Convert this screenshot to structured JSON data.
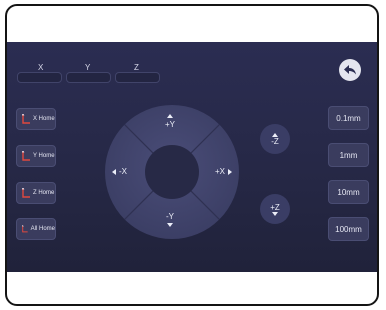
{
  "coordinates": {
    "x_label": "X",
    "y_label": "Y",
    "z_label": "Z"
  },
  "home_buttons": [
    {
      "label": "X Home"
    },
    {
      "label": "Y Home"
    },
    {
      "label": "Z Home"
    },
    {
      "label": "All Home"
    }
  ],
  "jog": {
    "plus_y": "+Y",
    "minus_y": "-Y",
    "minus_x": "-X",
    "plus_x": "+X"
  },
  "z_buttons": {
    "minus_z": "-Z",
    "plus_z": "+Z"
  },
  "step_buttons": [
    {
      "label": "0.1mm"
    },
    {
      "label": "1mm"
    },
    {
      "label": "10mm"
    },
    {
      "label": "100mm"
    }
  ],
  "icons": {
    "back": "back-arrow-icon",
    "home": "axis-home-icon"
  },
  "colors": {
    "screen_background": "#2b2d52",
    "button_background": "#3a3c5e",
    "axis_icon_red": "#e0483e",
    "text": "#e6e7f3"
  }
}
